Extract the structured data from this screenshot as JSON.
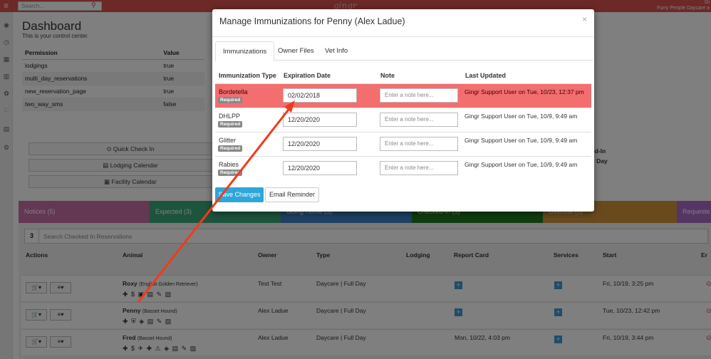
{
  "topbar": {
    "search_placeholder": "Search...",
    "logo": "gingr",
    "user_line1": "Gi",
    "user_line2": "Furry People Daycare a"
  },
  "dashboard": {
    "title": "Dashboard",
    "subtitle": "This is your control center.",
    "permissions": {
      "header_permission": "Permission",
      "header_value": "Value",
      "rows": [
        {
          "permission": "lodgings",
          "value": "true"
        },
        {
          "permission": "multi_day_reservations",
          "value": "true"
        },
        {
          "permission": "new_reservation_page",
          "value": "true"
        },
        {
          "permission": "two_way_sms",
          "value": "false"
        }
      ]
    },
    "quick_buttons": [
      {
        "label": "⊙ Quick Check In"
      },
      {
        "label": "▤ Lodging Calendar"
      },
      {
        "label": "▦ Facility Calendar"
      }
    ],
    "right_fragments": [
      "ed-In",
      "ll Day"
    ],
    "status_tabs": [
      {
        "label": "Notices (5)",
        "color": "#c86fa6"
      },
      {
        "label": "Expected (3)",
        "color": "#3aa87a"
      },
      {
        "label": "Going Home (3)",
        "color": "#3a82c4"
      },
      {
        "label": "Checked-In (3)",
        "color": "#1f7a1f"
      },
      {
        "label": "Overdue (0)",
        "color": "#d0943a"
      },
      {
        "label": "Requeste",
        "color": "#a96bc9"
      }
    ]
  },
  "reservations": {
    "count": "3",
    "search_placeholder": "Search Checked In Reservations",
    "columns": [
      "Actions",
      "Animal",
      "Owner",
      "Type",
      "Lodging",
      "Report Card",
      "Services",
      "Start",
      "Er"
    ],
    "rows": [
      {
        "name": "Roxy",
        "breed": "(English Golden Retriever)",
        "owner": "Test Test",
        "type": "Daycare | Full Day",
        "report_card": "",
        "start": "Fri, 10/19, 3:25 pm",
        "icons": "✚ $ ▣ ▤ ✎ ▨"
      },
      {
        "name": "Penny",
        "breed": "(Basset Hound)",
        "owner": "Alex Ladue",
        "type": "Daycare | Full Day",
        "report_card": "",
        "start": "Tue, 10/23, 12:42 pm",
        "icons": "✚ ⛨ ◈ ▤ ✎ ▨"
      },
      {
        "name": "Fred",
        "breed": "(Basset Hound)",
        "owner": "Alex Ladue",
        "type": "Daycare | Full Day",
        "report_card": "Mon, 10/22, 4:03 pm",
        "start": "Fri, 10/19, 3:44 pm",
        "icons": "✚ $ ✈ ✚ ⚠ ◈ ▤ ✎ ▨"
      }
    ]
  },
  "modal": {
    "title": "Manage Immunizations for Penny (Alex Ladue)",
    "close": "×",
    "tabs": [
      {
        "label": "Immunizations"
      },
      {
        "label": "Owner Files"
      },
      {
        "label": "Vet Info"
      }
    ],
    "headers": {
      "type": "Immunization Type",
      "expiration": "Expiration Date",
      "note": "Note",
      "updated": "Last Updated"
    },
    "note_placeholder": "Enter a note here...",
    "required_label": "Required",
    "rows": [
      {
        "type": "Bordetella",
        "expiration": "02/02/2018",
        "updated": "Gingr Support User on Tue, 10/23, 12:37 pm",
        "expired": true
      },
      {
        "type": "DHLPP",
        "expiration": "12/20/2020",
        "updated": "Gingr Support User on Tue, 10/9, 9:49 am",
        "expired": false
      },
      {
        "type": "Glitter",
        "expiration": "12/20/2020",
        "updated": "Gingr Support User on Tue, 10/9, 9:49 am",
        "expired": false
      },
      {
        "type": "Rabies",
        "expiration": "12/20/2020",
        "updated": "Gingr Support User on Tue, 10/9, 9:49 am",
        "expired": false
      }
    ],
    "save_label": "Save Changes",
    "email_label": "Email Reminder"
  },
  "annotation": {
    "arrow_color": "#f2391d"
  }
}
